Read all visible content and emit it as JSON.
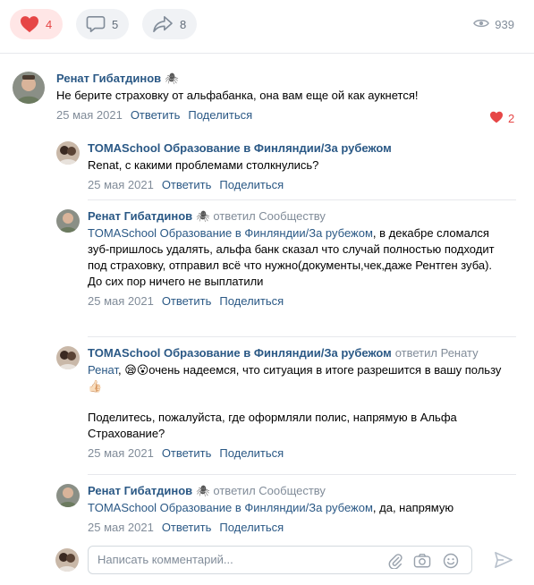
{
  "reactions": {
    "likes": "4",
    "comments": "5",
    "shares": "8",
    "views": "939"
  },
  "comments": [
    {
      "author": "Ренат Гибатдинов",
      "spider": "🕷",
      "replied": "",
      "text_prefix": "",
      "text": "Не берите страховку от альфабанка, она вам еще ой как аукнется!",
      "date": "25 мая 2021",
      "reply": "Ответить",
      "share": "Поделиться",
      "likes": "2"
    },
    {
      "author": "TOMASchool Образование в Финляндии/За рубежом",
      "text": "Renat, с какими проблемами столкнулись?",
      "date": "25 мая 2021",
      "reply": "Ответить",
      "share": "Поделиться"
    },
    {
      "author": "Ренат Гибатдинов",
      "spider": "🕷",
      "replied": "ответил Сообществу",
      "mention": "TOMASchool Образование в Финляндии/За рубежом",
      "text": ", в декабре сломался зуб-пришлось удалять, альфа банк сказал что случай полностью подходит под страховку, отправил всё что нужно(документы,чек,даже Рентген зуба). До сих пор ничего не выплатили",
      "date": "25 мая 2021",
      "reply": "Ответить",
      "share": "Поделиться"
    },
    {
      "author": "TOMASchool Образование в Финляндии/За рубежом",
      "replied": "ответил Ренату",
      "mention": "Ренат",
      "text": ", 😪😮очень надеемся, что ситуация в итоге разрешится в вашу пользу👍🏻",
      "text2": "Поделитесь, пожалуйста, где оформляли полис, напрямую в Альфа Страхование?",
      "date": "25 мая 2021",
      "reply": "Ответить",
      "share": "Поделиться"
    },
    {
      "author": "Ренат Гибатдинов",
      "spider": "🕷",
      "replied": "ответил Сообществу",
      "mention": "TOMASchool Образование в Финляндии/За рубежом",
      "text": ", да, напрямую",
      "date": "25 мая 2021",
      "reply": "Ответить",
      "share": "Поделиться"
    }
  ],
  "composer": {
    "placeholder": "Написать комментарий..."
  },
  "colors": {
    "link": "#2a5885",
    "muted": "#818c99",
    "like": "#e64646"
  }
}
